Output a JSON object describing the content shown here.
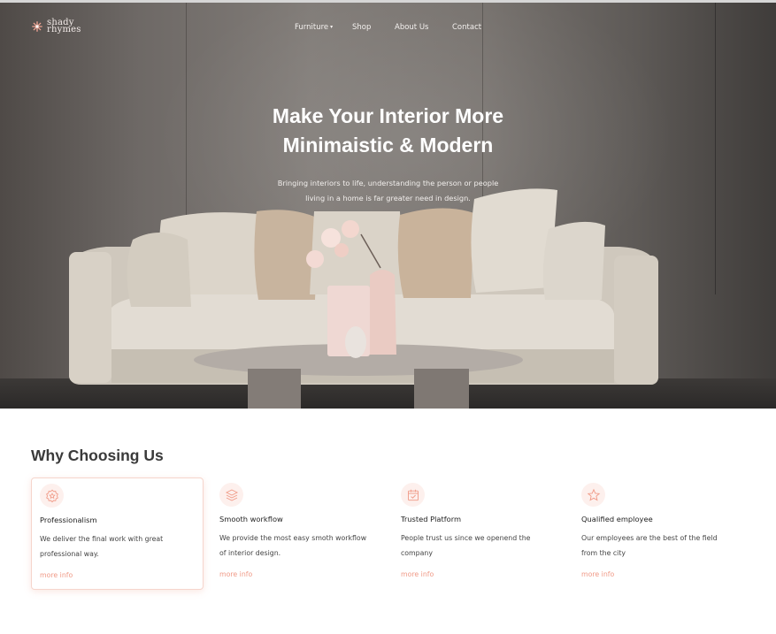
{
  "brand": {
    "line1": "shady",
    "line2": "rhymes",
    "accent_color": "#f2a594"
  },
  "nav": {
    "items": [
      {
        "label": "Furniture",
        "has_dropdown": true
      },
      {
        "label": "Shop"
      },
      {
        "label": "About Us"
      },
      {
        "label": "Contact"
      }
    ]
  },
  "hero": {
    "title_line1": "Make Your Interior More",
    "title_line2": "Minimaistic & Modern",
    "subtitle_line1": "Bringing interiors to life, understanding the person or people",
    "subtitle_line2": "living in a home is far greater need in design."
  },
  "why": {
    "title": "Why Choosing Us",
    "cards": [
      {
        "icon": "badge-star-icon",
        "title": "Professionalism",
        "desc_line1": "We deliver the final work with great",
        "desc_line2": "professional way.",
        "link": "more info"
      },
      {
        "icon": "layers-icon",
        "title": "Smooth workflow",
        "desc_line1": "We provide the most easy smoth workflow",
        "desc_line2": "of interior design.",
        "link": "more info"
      },
      {
        "icon": "calendar-check-icon",
        "title": "Trusted Platform",
        "desc_line1": "People trust us since we openend the",
        "desc_line2": "company",
        "link": "more info"
      },
      {
        "icon": "star-icon",
        "title": "Qualified employee",
        "desc_line1": "Our employees are the best of the field",
        "desc_line2": "from the city",
        "link": "more info"
      }
    ]
  },
  "colors": {
    "accent": "#f09a87",
    "icon_bg": "#fdf0ed",
    "card_border": "#f6d5cc"
  }
}
